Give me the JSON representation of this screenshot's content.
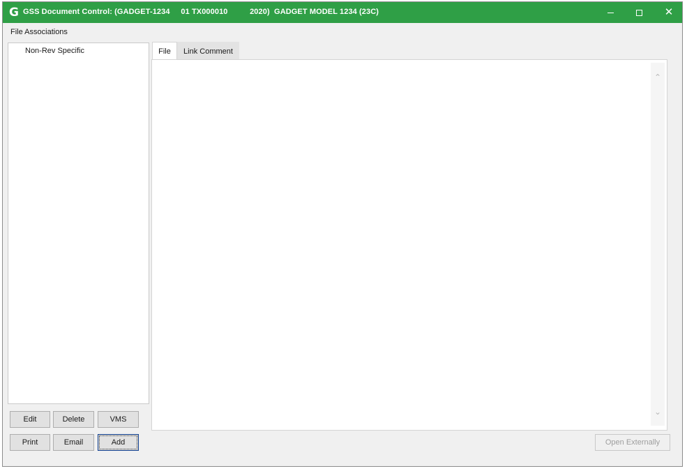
{
  "window": {
    "logo_letter": "G",
    "title": "GSS Document Control: (GADGET-1234     01 TX000010          2020)  GADGET MODEL 1234 (23C)",
    "minimize_glyph": "—",
    "maximize_glyph": "☐",
    "close_glyph": "✕",
    "accent_color": "#2f9f46"
  },
  "file_associations": {
    "label": "File Associations",
    "items": [
      "Non-Rev Specific"
    ]
  },
  "tabs": [
    {
      "label": "File",
      "active": true
    },
    {
      "label": "Link Comment",
      "active": false
    }
  ],
  "scrollbar": {
    "up_glyph": "⌃",
    "down_glyph": "⌄"
  },
  "buttons": {
    "edit": "Edit",
    "delete": "Delete",
    "vms": "VMS",
    "print": "Print",
    "email": "Email",
    "add": "Add",
    "open_externally": "Open Externally"
  }
}
